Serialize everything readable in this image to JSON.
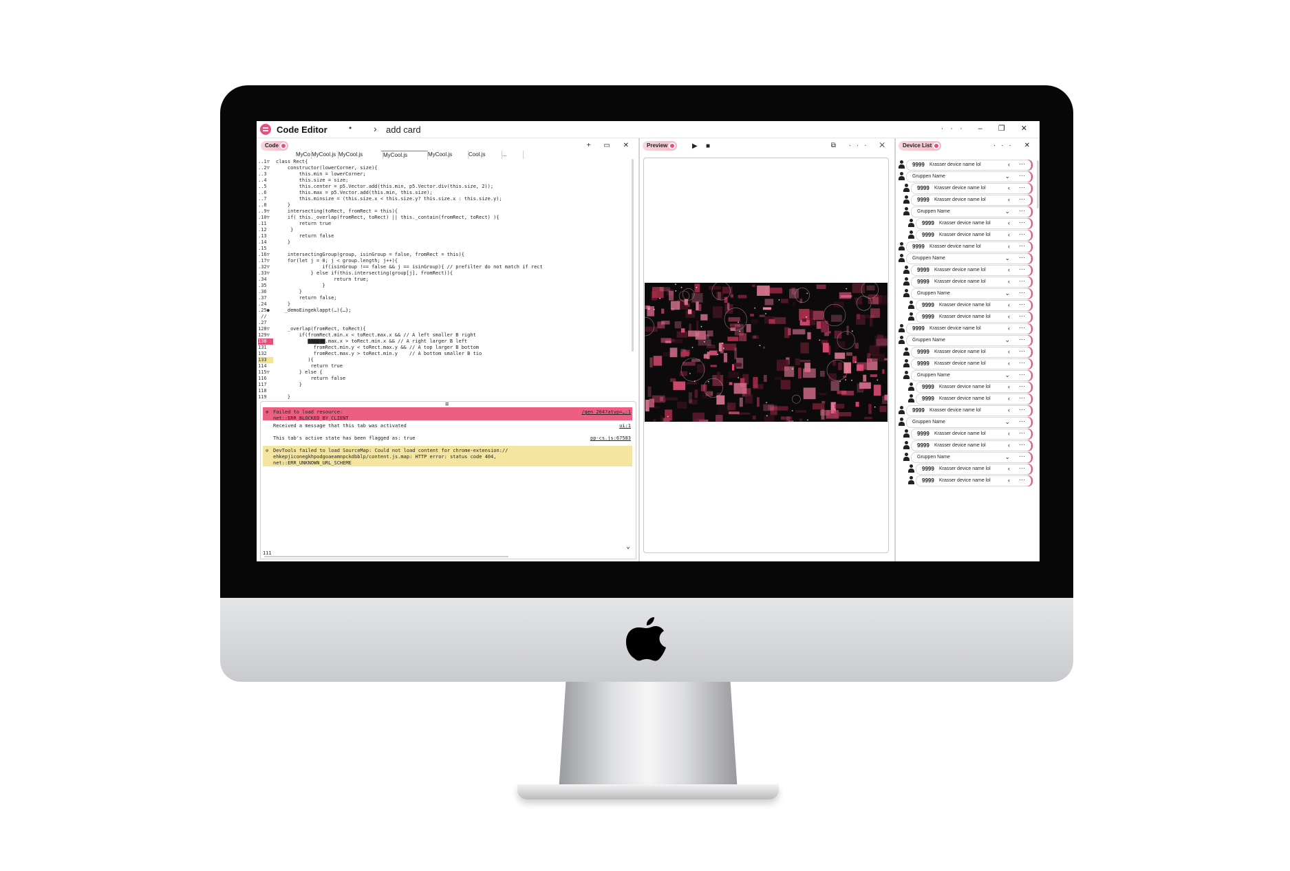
{
  "app": {
    "title": "Code Editor",
    "separator": "•",
    "breadcrumb": "add card",
    "window_controls": "··· – ❐ ✕"
  },
  "code_panel": {
    "pill": "Code",
    "header_icons": "+ ▭ ✕",
    "tabs": [
      "MyCo",
      "MyCool.js",
      "MyCool.js",
      "MyCool.js",
      "MyCool.js",
      "Cool.js",
      "..."
    ],
    "lines": [
      {
        "n": "..1▽",
        "t": "class Rect{"
      },
      {
        "n": "..2▽",
        "t": "    constructor(lowerCorner, size){"
      },
      {
        "n": "..3",
        "t": "        this.min = lowerCorner;"
      },
      {
        "n": "..4",
        "t": "        this.size = size;"
      },
      {
        "n": "..5",
        "t": "        this.center = p5.Vector.add(this.min, p5.Vector.div(this.size, 2));"
      },
      {
        "n": "..6",
        "t": "        this.max = p5.Vector.add(this.min, this.size);"
      },
      {
        "n": "..7",
        "t": "        this.minsize = (this.size.x < this.size.y? this.size.x : this.size.y);"
      },
      {
        "n": "..8",
        "t": "    }"
      },
      {
        "n": "..9▽",
        "t": "    intersecting(toRect, fromRect = this){"
      },
      {
        "n": ".10▽",
        "t": "    if( this._overlap(fromRect, toRect) || this._contain(fromRect, toRect) ){"
      },
      {
        "n": ".11",
        "t": "        return true"
      },
      {
        "n": ".12",
        "t": "     }"
      },
      {
        "n": ".13",
        "t": "        return false"
      },
      {
        "n": ".14",
        "t": "    }"
      },
      {
        "n": ".15",
        "t": ""
      },
      {
        "n": ".16▽",
        "t": "    intersectingGroup(group, isinGroup = false, fromRect = this){"
      },
      {
        "n": ".17▽",
        "t": "    for(let j = 0; j < group.length; j++){"
      },
      {
        "n": ".32▽",
        "t": "                if(isinGroup !== false && j == isinGroup){ // prefilter do not match if rect"
      },
      {
        "n": ".33▽",
        "t": "            } else if(this.intersecting(group[j], fromRect)){"
      },
      {
        "n": ".34",
        "t": "                    return true;"
      },
      {
        "n": ".35",
        "t": "                }"
      },
      {
        "n": ".36",
        "t": "        }"
      },
      {
        "n": ".37",
        "t": "        return false;"
      },
      {
        "n": ".24",
        "t": "    }"
      },
      {
        "n": ".25●",
        "t": "   _demoEingeklappt(…){…};"
      },
      {
        "n": " //",
        "t": ""
      },
      {
        "n": ".27",
        "t": ""
      },
      {
        "n": "128▽",
        "t": "    _overlap(fromRect, toRect){"
      },
      {
        "n": "129▽",
        "t": "        if(fromRect.min.x < toRect.max.x && // A left smaller B right"
      },
      {
        "n": "130",
        "t": "           ▇▇▇▇▇▇.max.x > toRect.min.x && // A right larger B left",
        "mark": "err"
      },
      {
        "n": "131",
        "t": "             fromRect.min.y < toRect.max.y && // A top larger B bottom"
      },
      {
        "n": "132",
        "t": "             fromRect.max.y > toRect.min.y    // A bottom smaller B tio"
      },
      {
        "n": "133",
        "t": "           ){",
        "mark": "warn"
      },
      {
        "n": "114",
        "t": "            return true"
      },
      {
        "n": "115▽",
        "t": "        } else {"
      },
      {
        "n": "116",
        "t": "            return false"
      },
      {
        "n": "117",
        "t": "        }"
      },
      {
        "n": "118",
        "t": ""
      },
      {
        "n": "119",
        "t": "    }"
      }
    ]
  },
  "console": {
    "grip": "≡",
    "rows": [
      {
        "type": "error",
        "icon": "⊗",
        "msg": "Failed to load resource:\nnet::ERR_BLOCKED_BY_CLIENT",
        "src": "/gen_204?atyp=…:1"
      },
      {
        "type": "info",
        "icon": "",
        "msg": "Received a message that this tab was activated",
        "src": "ui:1"
      },
      {
        "type": "info",
        "icon": "",
        "msg": "This tab's active state has been flagged as: true",
        "src": "pp-cs.js:67583"
      },
      {
        "type": "warning",
        "icon": "⊙",
        "msg": "DevTools failed to load SourceMap: Could not load content for chrome-extension://\nehkepjiconegkhpodgoaeamnpckdbblp/content.js.map: HTTP error: status code 404,\nnet::ERR_UNKNOWN_URL_SCHEME",
        "src": ""
      }
    ],
    "footer_line": "111",
    "chevron": "⌄"
  },
  "preview_panel": {
    "pill": "Preview",
    "play": "▶",
    "stop": "■",
    "header_icons": "⧉ ··· ✕"
  },
  "device_panel": {
    "pill": "Device List",
    "header_icons": "··· ✕",
    "rows": [
      {
        "kind": "device",
        "indent": 0,
        "num": "9999",
        "name": "Krasser device name lol",
        "chev": "‹"
      },
      {
        "kind": "group",
        "indent": 0,
        "name": "Gruppen Name",
        "chev": "⌄"
      },
      {
        "kind": "device",
        "indent": 1,
        "num": "9999",
        "name": "Krasser device name lol",
        "chev": "‹"
      },
      {
        "kind": "device",
        "indent": 1,
        "num": "9999",
        "name": "Krasser device name lol",
        "chev": "‹"
      },
      {
        "kind": "group",
        "indent": 1,
        "name": "Gruppen Name",
        "chev": "⌄"
      },
      {
        "kind": "device",
        "indent": 2,
        "num": "9999",
        "name": "Krasser device name lol",
        "chev": "‹"
      },
      {
        "kind": "device",
        "indent": 2,
        "num": "9999",
        "name": "Krasser device name lol",
        "chev": "‹"
      },
      {
        "kind": "device",
        "indent": 0,
        "num": "9999",
        "name": "Krasser device name lol",
        "chev": "‹"
      },
      {
        "kind": "group",
        "indent": 0,
        "name": "Gruppen Name",
        "chev": "⌄"
      },
      {
        "kind": "device",
        "indent": 1,
        "num": "9999",
        "name": "Krasser device name lol",
        "chev": "‹"
      },
      {
        "kind": "device",
        "indent": 1,
        "num": "9999",
        "name": "Krasser device name lol",
        "chev": "‹"
      },
      {
        "kind": "group",
        "indent": 1,
        "name": "Gruppen Name",
        "chev": "⌄"
      },
      {
        "kind": "device",
        "indent": 2,
        "num": "9999",
        "name": "Krasser device name lol",
        "chev": "‹"
      },
      {
        "kind": "device",
        "indent": 2,
        "num": "9999",
        "name": "Krasser device name lol",
        "chev": "‹"
      },
      {
        "kind": "device",
        "indent": 0,
        "num": "9999",
        "name": "Krasser device name lol",
        "chev": "‹"
      },
      {
        "kind": "group",
        "indent": 0,
        "name": "Gruppen Name",
        "chev": "⌄"
      },
      {
        "kind": "device",
        "indent": 1,
        "num": "9999",
        "name": "Krasser device name lol",
        "chev": "‹"
      },
      {
        "kind": "device",
        "indent": 1,
        "num": "9999",
        "name": "Krasser device name lol",
        "chev": "‹"
      },
      {
        "kind": "group",
        "indent": 1,
        "name": "Gruppen Name",
        "chev": "⌄"
      },
      {
        "kind": "device",
        "indent": 2,
        "num": "9999",
        "name": "Krasser device name lol",
        "chev": "‹"
      },
      {
        "kind": "device",
        "indent": 2,
        "num": "9999",
        "name": "Krasser device name lol",
        "chev": "‹"
      },
      {
        "kind": "device",
        "indent": 0,
        "num": "9999",
        "name": "Krasser device name lol",
        "chev": "‹"
      },
      {
        "kind": "group",
        "indent": 0,
        "name": "Gruppen Name",
        "chev": "⌄"
      },
      {
        "kind": "device",
        "indent": 1,
        "num": "9999",
        "name": "Krasser device name lol",
        "chev": "‹"
      },
      {
        "kind": "device",
        "indent": 1,
        "num": "9999",
        "name": "Krasser device name lol",
        "chev": "‹"
      },
      {
        "kind": "group",
        "indent": 1,
        "name": "Gruppen Name",
        "chev": "⌄"
      },
      {
        "kind": "device",
        "indent": 2,
        "num": "9999",
        "name": "Krasser device name lol",
        "chev": "‹"
      },
      {
        "kind": "device",
        "indent": 2,
        "num": "9999",
        "name": "Krasser device name lol",
        "chev": "‹"
      }
    ]
  },
  "colors": {
    "accent": "#e8507a",
    "error_bg": "#ec5f82",
    "warning_bg": "#f4e6a0"
  },
  "syntax": {
    "keyword": "#3a4fd0",
    "method": "#2e9a6a",
    "number": "#9a3ad0",
    "comment": "#9a9a9a"
  }
}
